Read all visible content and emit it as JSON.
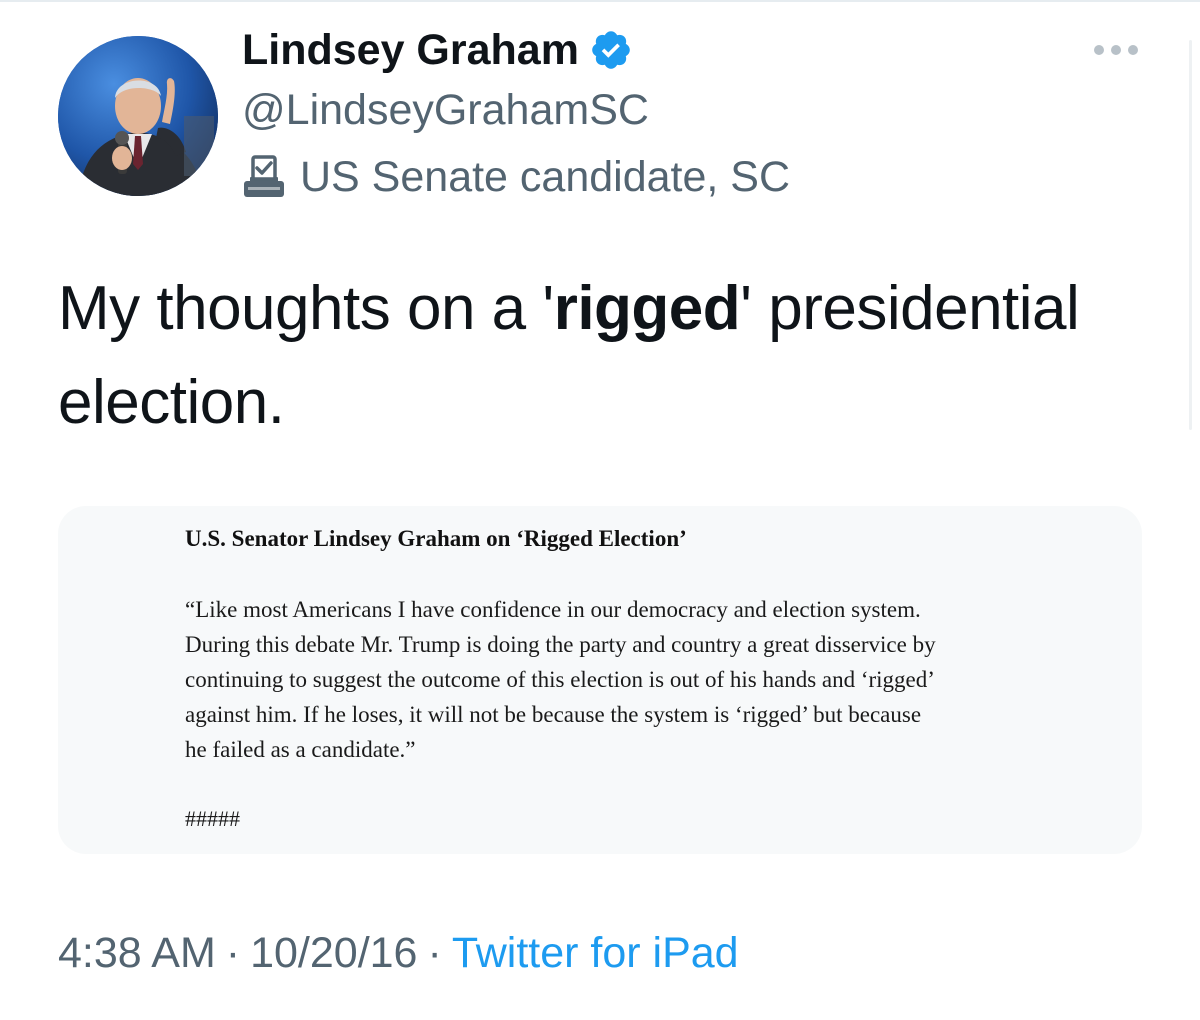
{
  "tweet": {
    "author": {
      "display_name": "Lindsey Graham",
      "handle": "@LindseyGrahamSC",
      "verified": true,
      "label": "US Senate candidate, SC",
      "label_icon": "ballot-box-icon"
    },
    "text": {
      "before": "My thoughts on a '",
      "bold": "rigged",
      "after": "' presidential election."
    },
    "statement": {
      "title": "U.S. Senator Lindsey Graham on ‘Rigged Election’",
      "body_lines": [
        "“Like most Americans I have confidence in our democracy and election system.",
        "During this debate Mr. Trump is doing the party and country a great disservice by",
        "continuing to suggest the outcome of this election is out of his hands and ‘rigged’",
        "against him.  If he loses, it will not be because the system is ‘rigged’ but because",
        "he failed as a candidate.”"
      ],
      "end_mark": "#####"
    },
    "time": "4:38 AM",
    "date": "10/20/16",
    "separator": "·",
    "source": "Twitter for iPad"
  },
  "colors": {
    "text_primary": "#0f1419",
    "text_secondary": "#536471",
    "link": "#1d9bf0",
    "verified": "#1d9bf0",
    "card_background": "#f7f9fa"
  }
}
